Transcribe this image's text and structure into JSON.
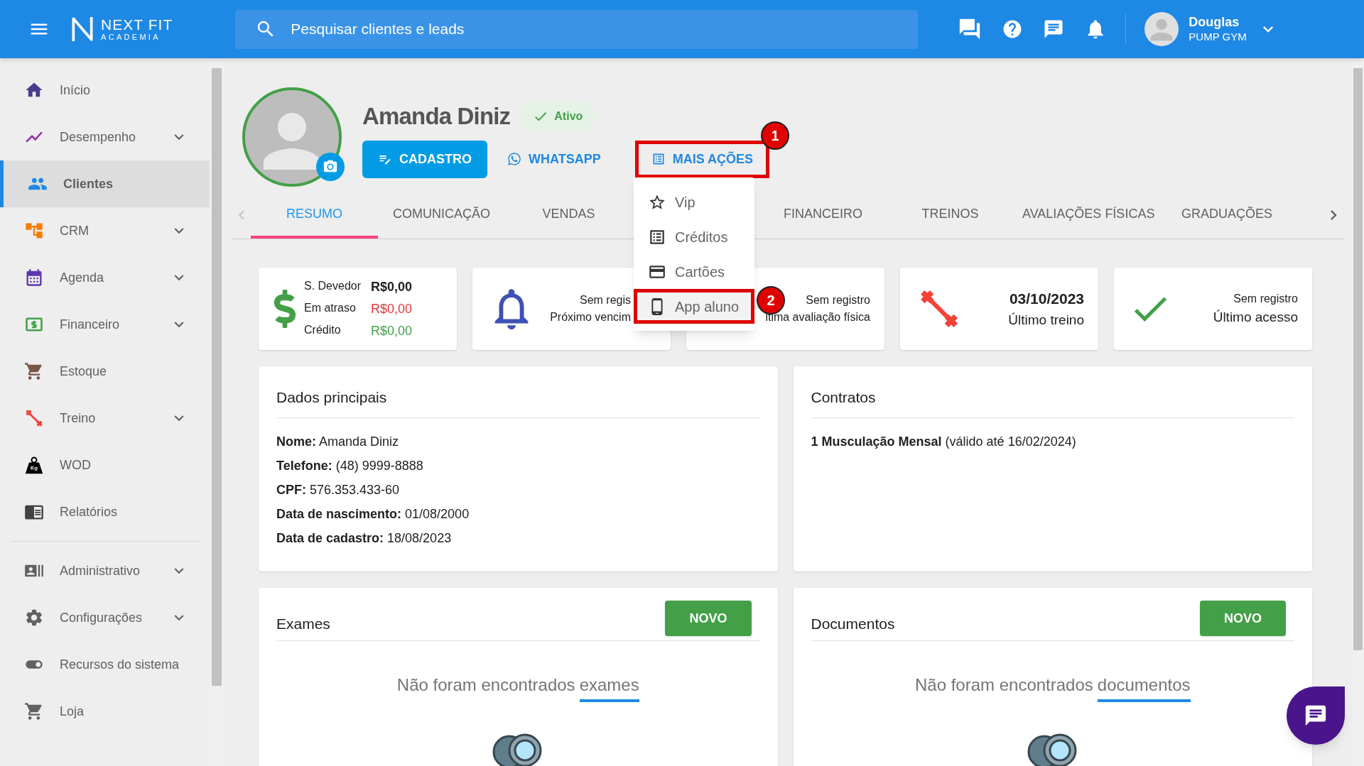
{
  "topbar": {
    "logo": {
      "name": "NEXT FIT",
      "sub": "ACADEMIA"
    },
    "search": {
      "placeholder": "Pesquisar clientes e leads"
    },
    "user": {
      "name": "Douglas",
      "gym": "PUMP GYM"
    }
  },
  "sidebar": {
    "sections": [
      [
        {
          "label": "Início",
          "expandable": false,
          "selected": false
        },
        {
          "label": "Desempenho",
          "expandable": true,
          "selected": false
        },
        {
          "label": "Clientes",
          "expandable": false,
          "selected": true
        },
        {
          "label": "CRM",
          "expandable": true,
          "selected": false
        },
        {
          "label": "Agenda",
          "expandable": true,
          "selected": false
        },
        {
          "label": "Financeiro",
          "expandable": true,
          "selected": false
        },
        {
          "label": "Estoque",
          "expandable": false,
          "selected": false
        },
        {
          "label": "Treino",
          "expandable": true,
          "selected": false
        },
        {
          "label": "WOD",
          "expandable": false,
          "selected": false
        },
        {
          "label": "Relatórios",
          "expandable": false,
          "selected": false
        }
      ],
      [
        {
          "label": "Administrativo",
          "expandable": true,
          "selected": false
        },
        {
          "label": "Configurações",
          "expandable": true,
          "selected": false
        },
        {
          "label": "Recursos do sistema",
          "expandable": false,
          "selected": false
        },
        {
          "label": "Loja",
          "expandable": false,
          "selected": false
        }
      ]
    ]
  },
  "profile": {
    "name": "Amanda Diniz",
    "status": "Ativo",
    "actions": [
      {
        "label": "CADASTRO",
        "kind": "primary",
        "highlighted": false
      },
      {
        "label": "WHATSAPP",
        "kind": "link",
        "highlighted": false
      },
      {
        "label": "MAIS AÇÕES",
        "kind": "link",
        "highlighted": true,
        "annotation": "1"
      }
    ]
  },
  "menu": {
    "items": [
      {
        "label": "Vip",
        "highlighted": false
      },
      {
        "label": "Créditos",
        "highlighted": false
      },
      {
        "label": "Cartões",
        "highlighted": false
      },
      {
        "label": "App aluno",
        "highlighted": true,
        "annotation": "2"
      }
    ]
  },
  "tabs": [
    {
      "label": "RESUMO",
      "selected": true
    },
    {
      "label": "COMUNICAÇÃO",
      "selected": false
    },
    {
      "label": "VENDAS",
      "selected": false
    },
    {
      "label": "FINANCEIRO",
      "selected": false
    },
    {
      "label": "TREINOS",
      "selected": false
    },
    {
      "label": "AVALIAÇÕES FÍSICAS",
      "selected": false
    },
    {
      "label": "GRADUAÇÕES",
      "selected": false
    }
  ],
  "summary_cards": [
    {
      "kind": "balance",
      "rows": [
        {
          "label": "S. Devedor",
          "value": "R$0,00",
          "color": "#212121"
        },
        {
          "label": "Em atraso",
          "value": "R$0,00",
          "color": "#e53935"
        },
        {
          "label": "Crédito",
          "value": "R$0,00",
          "color": "#43a047"
        }
      ]
    },
    {
      "kind": "info",
      "lines": [
        "Sem regis",
        "Próximo vencim"
      ]
    },
    {
      "kind": "info",
      "lines": [
        "Sem registro",
        "ltima avaliação física"
      ]
    },
    {
      "kind": "info",
      "lines": [
        "03/10/2023",
        "Último treino"
      ]
    },
    {
      "kind": "info",
      "lines": [
        "Sem registro",
        "Último acesso"
      ]
    }
  ],
  "main_data": {
    "title": "Dados principais",
    "fields": [
      "**Nome:** Amanda Diniz",
      "**Telefone:** (48) 9999-8888",
      "**CPF:** 576.353.433-60",
      "**Data de nascimento:** 01/08/2000",
      "**Data de cadastro:** 18/08/2023"
    ]
  },
  "contracts": {
    "title": "Contratos",
    "items": [
      "**1 Musculação Mensal** (válido até 16/02/2024)"
    ]
  },
  "lists": [
    {
      "title": "Exames",
      "button": "NOVO",
      "empty_text": "Não foram encontrados",
      "empty_keyword": "exames"
    },
    {
      "title": "Documentos",
      "button": "NOVO",
      "empty_text": "Não foram encontrados",
      "empty_keyword": "documentos"
    }
  ]
}
